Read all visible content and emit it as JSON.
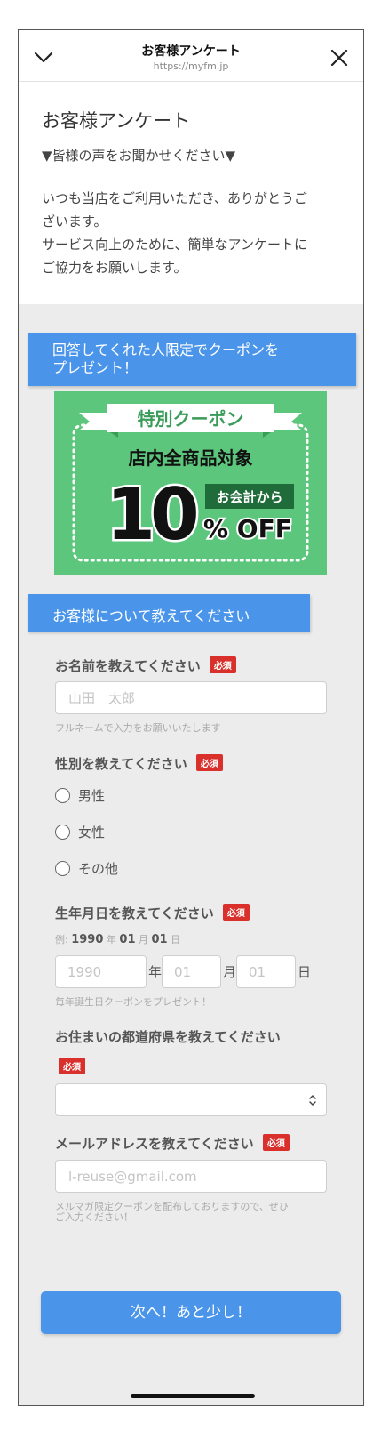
{
  "browser": {
    "title": "お客様アンケート",
    "url": "https://myfm.jp"
  },
  "intro": {
    "title": "お客様アンケート",
    "subtitle": "▼皆様の声をお聞かせください▼",
    "body_line1": "いつも当店をご利用いただき、ありがとうご",
    "body_line2": "ざいます。",
    "body_line3": "サービス向上のために、簡単なアンケートに",
    "body_line4": "ご協力をお願いします。"
  },
  "coupon_banner": {
    "line1": "回答してくれた人限定でクーポンを",
    "line2": "プレゼント！"
  },
  "coupon": {
    "ribbon": "特別クーポン",
    "target": "店内全商品対象",
    "number": "10",
    "tag": "お会計から",
    "off": "% OFF"
  },
  "section_banner": "お客様について教えてください",
  "required_label": "必須",
  "name_q": {
    "label": "お名前を教えてください",
    "placeholder": "山田　太郎",
    "hint": "フルネームで入力をお願いいたします"
  },
  "gender_q": {
    "label": "性別を教えてください",
    "options": [
      "男性",
      "女性",
      "その他"
    ]
  },
  "birth_q": {
    "label": "生年月日を教えてください",
    "example_prefix": "例:",
    "example_year": "1990",
    "year_unit": "年",
    "example_month": "01",
    "month_unit": "月",
    "example_day": "01",
    "day_unit": "日",
    "year_placeholder": "1990",
    "month_placeholder": "01",
    "day_placeholder": "01",
    "hint": "毎年誕生日クーポンをプレゼント！"
  },
  "pref_q": {
    "label": "お住まいの都道府県を教えてください",
    "selected": ""
  },
  "email_q": {
    "label": "メールアドレスを教えてください",
    "placeholder": "l-reuse@gmail.com",
    "hint_line1": "メルマガ限定クーポンを配布しておりますので、ぜひ",
    "hint_line2": "ご入力ください！"
  },
  "next_button": "次へ！あと少し！",
  "colors": {
    "accent_blue": "#4a95ea",
    "coupon_green": "#5cc67c",
    "required_red": "#d9302c",
    "form_bg": "#ececec"
  }
}
